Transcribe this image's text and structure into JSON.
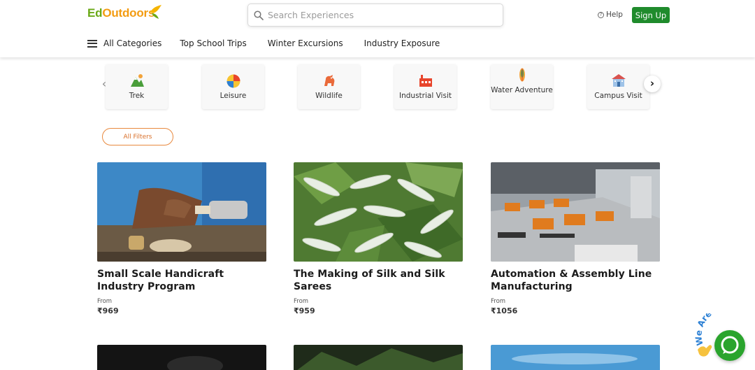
{
  "brand": {
    "name_part1": "Ed",
    "name_part2": "Outdoors",
    "green": "#6aa917",
    "orange": "#f39c12"
  },
  "search": {
    "placeholder": "Search Experiences",
    "icon": "search-icon"
  },
  "header": {
    "help_label": "Help",
    "signup_label": "Sign Up",
    "signup_color": "#1f8b2c"
  },
  "nav": {
    "all_categories": "All Categories",
    "items": [
      "Top School Trips",
      "Winter Excursions",
      "Industry Exposure"
    ]
  },
  "categories": [
    {
      "label": "Trek",
      "icon": "trek-icon"
    },
    {
      "label": "Leisure",
      "icon": "beach-ball-icon"
    },
    {
      "label": "Wildlife",
      "icon": "wildlife-icon"
    },
    {
      "label": "Industrial Visit",
      "icon": "factory-icon"
    },
    {
      "label": "Water Adventure",
      "icon": "surfboard-icon"
    },
    {
      "label": "Campus Visit",
      "icon": "campus-icon"
    }
  ],
  "filters": {
    "label": "All Filters",
    "accent": "#e8893e"
  },
  "experiences": [
    {
      "title": "Small Scale Handicraft Industry Program",
      "from_label": "From",
      "price": "₹969"
    },
    {
      "title": "The Making of Silk and Silk Sarees",
      "from_label": "From",
      "price": "₹959"
    },
    {
      "title": "Automation & Assembly Line Manufacturing",
      "from_label": "From",
      "price": "₹1056"
    }
  ],
  "chat": {
    "badge_text": "We Are Here!",
    "color": "#2aa42d"
  }
}
